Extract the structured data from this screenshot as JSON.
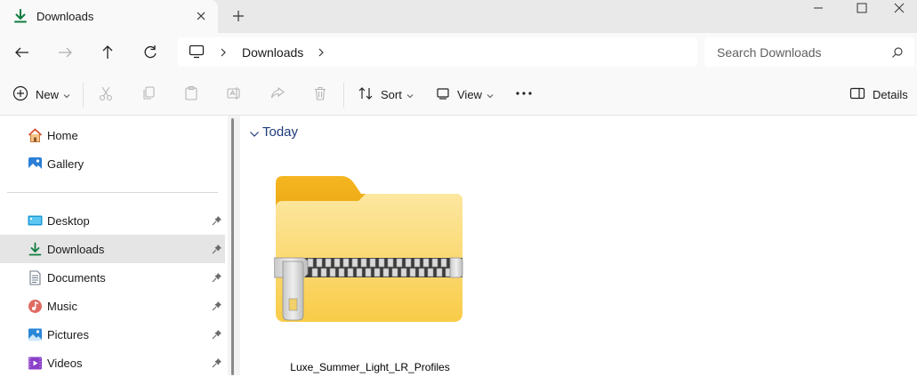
{
  "window": {
    "tab_title": "Downloads",
    "tab_icon": "download-icon",
    "colors": {
      "accent": "#0f7b3f",
      "folder": "#f8c93c",
      "selected": "#e5e5e5"
    }
  },
  "address_bar": {
    "path": [
      "Downloads"
    ],
    "search_placeholder": "Search Downloads"
  },
  "command_bar": {
    "new_label": "New",
    "sort_label": "Sort",
    "view_label": "View",
    "details_label": "Details"
  },
  "sidebar": {
    "items": [
      {
        "label": "Home",
        "icon": "home-icon",
        "pinned": false
      },
      {
        "label": "Gallery",
        "icon": "gallery-icon",
        "pinned": false
      },
      {
        "label": "Desktop",
        "icon": "desktop-icon",
        "pinned": true
      },
      {
        "label": "Downloads",
        "icon": "download-icon",
        "pinned": true,
        "selected": true
      },
      {
        "label": "Documents",
        "icon": "documents-icon",
        "pinned": true
      },
      {
        "label": "Music",
        "icon": "music-icon",
        "pinned": true
      },
      {
        "label": "Pictures",
        "icon": "pictures-icon",
        "pinned": true
      },
      {
        "label": "Videos",
        "icon": "videos-icon",
        "pinned": true
      }
    ]
  },
  "content": {
    "group_title": "Today",
    "files": [
      {
        "name": "Luxe_Summer_Light_LR_Profiles",
        "icon": "zip-folder-icon"
      }
    ]
  }
}
